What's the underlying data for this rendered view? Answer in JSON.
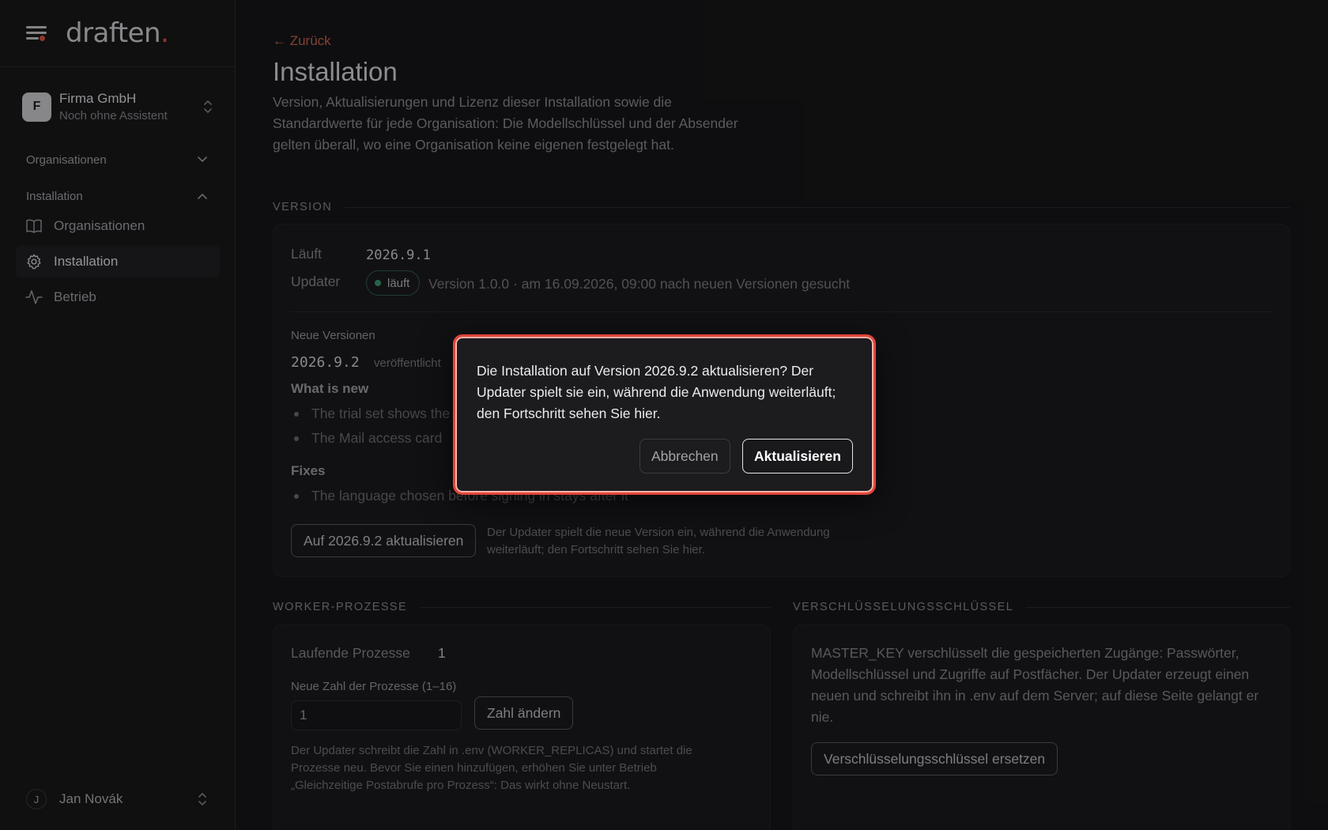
{
  "sidebar": {
    "logo_text": "draften",
    "logo_dot": ".",
    "org": {
      "initial": "F",
      "name": "Firma GmbH",
      "subtitle": "Noch ohne Assistent"
    },
    "sections": [
      {
        "label": "Organisationen",
        "expanded": false
      },
      {
        "label": "Installation",
        "expanded": true
      }
    ],
    "items": [
      {
        "label": "Organisationen",
        "icon": "book-icon",
        "active": false
      },
      {
        "label": "Installation",
        "icon": "gear-icon",
        "active": true
      },
      {
        "label": "Betrieb",
        "icon": "activity-icon",
        "active": false
      }
    ],
    "user": {
      "initial": "J",
      "name": "Jan Novák"
    }
  },
  "main": {
    "back_link": "← Zurück",
    "title": "Installation",
    "intro": "Version, Aktualisierungen und Lizenz dieser Installation sowie die Standardwerte für jede Organisation: Die Modellschlüssel und der Absender gelten überall, wo eine Organisation keine eigenen festgelegt hat.",
    "version": {
      "section_label": "VERSION",
      "running_label": "Läuft",
      "running_value": "2026.9.1",
      "updater_label": "Updater",
      "updater_status": "läuft",
      "updater_info": "Version 1.0.0 · am 16.09.2026, 09:00 nach neuen Versionen gesucht",
      "new_versions_label": "Neue Versionen",
      "new_version": "2026.9.2",
      "published_label": "veröffentlicht",
      "whats_new_heading": "What is new",
      "whats_new": [
        "The trial set shows the",
        "The Mail access card"
      ],
      "fixes_heading": "Fixes",
      "fixes": [
        "The language chosen before signing in stays after it"
      ],
      "update_button": "Auf 2026.9.2 aktualisieren",
      "update_hint": "Der Updater spielt die neue Version ein, während die Anwendung weiterläuft; den Fortschritt sehen Sie hier."
    },
    "workers": {
      "section_label": "WORKER-PROZESSE",
      "running_label": "Laufende Prozesse",
      "running_value": "1",
      "new_count_label": "Neue Zahl der Prozesse (1–16)",
      "input_value": "1",
      "change_button": "Zahl ändern",
      "hint": "Der Updater schreibt die Zahl in .env (WORKER_REPLICAS) und startet die Prozesse neu. Bevor Sie einen hinzufügen, erhöhen Sie unter Betrieb „Gleichzeitige Postabrufe pro Prozess“: Das wirkt ohne Neustart."
    },
    "encryption": {
      "section_label": "VERSCHLÜSSELUNGSSCHLÜSSEL",
      "text": "MASTER_KEY verschlüsselt die gespeicherten Zugänge: Passwörter, Modellschlüssel und Zugriffe auf Postfächer. Der Updater erzeugt einen neuen und schreibt ihn in .env auf dem Server; auf diese Seite gelangt er nie.",
      "button": "Verschlüsselungsschlüssel ersetzen"
    }
  },
  "dialog": {
    "message": "Die Installation auf Version 2026.9.2 aktualisieren? Der Updater spielt sie ein, während die Anwendung weiterläuft; den Fortschritt sehen Sie hier.",
    "cancel": "Abbrechen",
    "confirm": "Aktualisieren"
  },
  "colors": {
    "accent": "#e5533d",
    "status_ok": "#3f9a6e",
    "dialog_border": "#e0453a"
  }
}
